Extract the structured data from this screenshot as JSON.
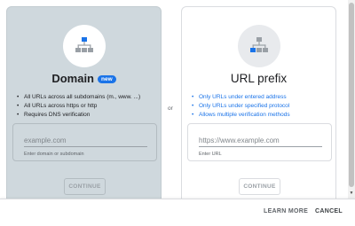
{
  "separator": {
    "or": "or"
  },
  "domain_card": {
    "title": "Domain",
    "badge": "new",
    "icon": "sitemap-icon",
    "bullets": [
      "All URLs across all subdomains (m., www. ...)",
      "All URLs across https or http",
      "Requires DNS verification"
    ],
    "input": {
      "placeholder": "example.com",
      "value": "",
      "hint": "Enter domain or subdomain"
    },
    "continue_label": "CONTINUE",
    "colors": {
      "background": "#cfd8dd",
      "icon_accent": "#1a73e8"
    }
  },
  "prefix_card": {
    "title": "URL prefix",
    "icon": "sitemap-icon",
    "bullets": [
      "Only URLs under entered address",
      "Only URLs under specified protocol",
      "Allows multiple verification methods"
    ],
    "input": {
      "placeholder": "https://www.example.com",
      "value": "",
      "hint": "Enter URL"
    },
    "continue_label": "CONTINUE",
    "colors": {
      "bullet_text": "#1a73e8",
      "icon_accent": "#1a73e8"
    }
  },
  "footer": {
    "learn_more_label": "LEARN MORE",
    "cancel_label": "CANCEL"
  }
}
